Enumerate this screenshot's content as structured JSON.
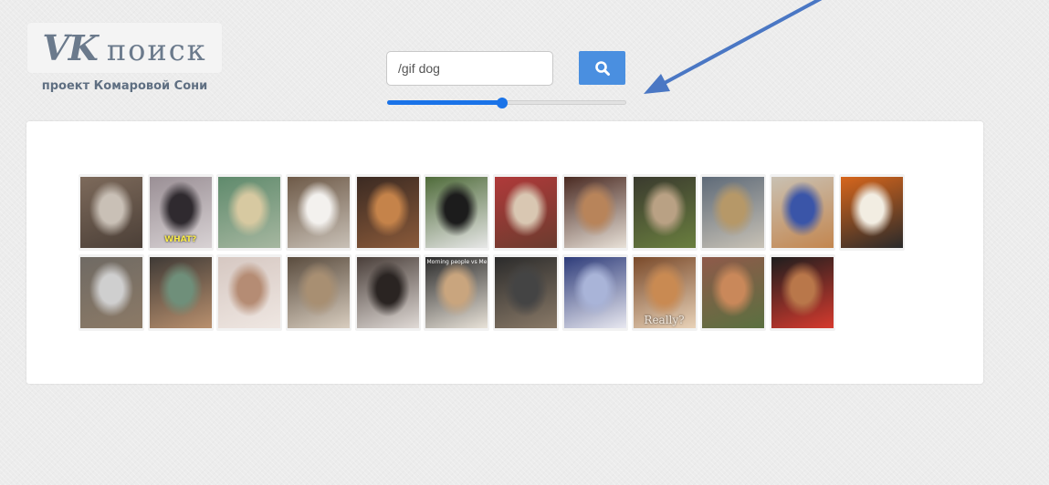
{
  "logo": {
    "brand": "VK",
    "word": "поиск"
  },
  "subtitle": "проект Комаровой Сони",
  "search": {
    "value": "/gif dog",
    "icon": "search-icon",
    "button_color": "#4a8fe0"
  },
  "slider": {
    "value_fraction": 0.48,
    "accent": "#1a73e8"
  },
  "annotation": {
    "icon": "arrow-icon",
    "color": "#4a77c4"
  },
  "results": {
    "rows": [
      [
        {
          "colors": [
            "#7d6a5b",
            "#c9c0b6",
            "#4b3f37"
          ]
        },
        {
          "colors": [
            "#9a8f95",
            "#2f2a2f",
            "#d8d2d4"
          ],
          "caption": "WHAT?"
        },
        {
          "colors": [
            "#5f8a6c",
            "#d7c9a1",
            "#a6b7a0"
          ]
        },
        {
          "colors": [
            "#6e5a48",
            "#f3f1ee",
            "#c8c0b6"
          ]
        },
        {
          "colors": [
            "#3b2a22",
            "#c5834a",
            "#8a5a3a"
          ]
        },
        {
          "colors": [
            "#4f6b3a",
            "#1c1c1c",
            "#e7e7e7"
          ]
        },
        {
          "colors": [
            "#b03a3a",
            "#d9c7b2",
            "#6b3b2e"
          ]
        },
        {
          "colors": [
            "#4a2a22",
            "#b8845a",
            "#e8e1d8"
          ]
        },
        {
          "colors": [
            "#3a3a2e",
            "#b9a184",
            "#6a7f3f"
          ]
        },
        {
          "colors": [
            "#5e6a78",
            "#b69868",
            "#c8c2b6"
          ]
        },
        {
          "colors": [
            "#c9c1b3",
            "#3a55a8",
            "#c3864f"
          ]
        },
        {
          "colors": [
            "#d7661c",
            "#f2ede2",
            "#2a2a2a"
          ]
        }
      ],
      [
        {
          "colors": [
            "#6f6a64",
            "#cfcfcf",
            "#8c7a66"
          ]
        },
        {
          "colors": [
            "#3f3a36",
            "#6f8f7a",
            "#b9906e"
          ]
        },
        {
          "colors": [
            "#d6c8c2",
            "#b58c74",
            "#efe7e2"
          ]
        },
        {
          "colors": [
            "#5a4c3e",
            "#a88f72",
            "#d8cdbf"
          ]
        },
        {
          "colors": [
            "#4a3f3a",
            "#2a2422",
            "#e0dad6"
          ]
        },
        {
          "colors": [
            "#2a2a2a",
            "#c9a57e",
            "#e8e2d8"
          ],
          "caption": "Morning people vs Me"
        },
        {
          "colors": [
            "#2b2b2b",
            "#444444",
            "#8a7a68"
          ]
        },
        {
          "colors": [
            "#2e3c7a",
            "#a9b4d8",
            "#e8e8f0"
          ]
        },
        {
          "colors": [
            "#7a4a2a",
            "#c98a52",
            "#e8d2b8"
          ],
          "caption": "Really?"
        },
        {
          "colors": [
            "#8f5a4a",
            "#c9885a",
            "#5a7040"
          ]
        },
        {
          "colors": [
            "#1e1e1e",
            "#b9774a",
            "#d63a2e"
          ]
        }
      ]
    ]
  }
}
